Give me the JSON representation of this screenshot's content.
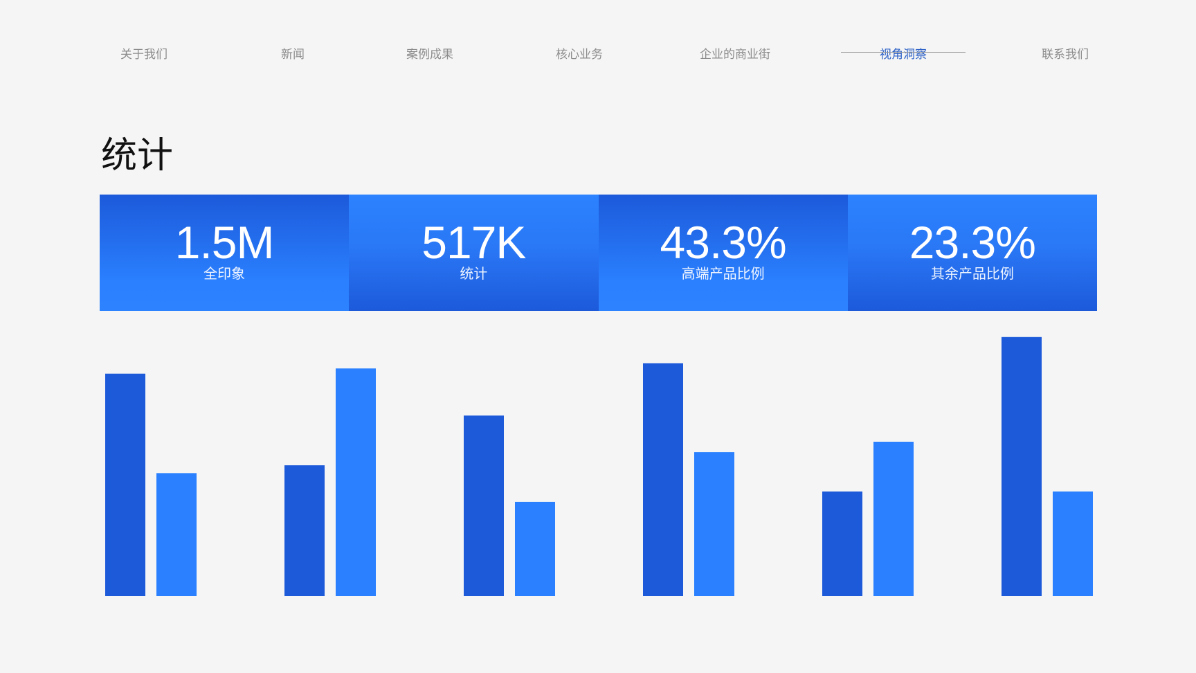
{
  "nav": {
    "items": [
      {
        "label": "关于我们",
        "active": false
      },
      {
        "label": "新闻",
        "active": false
      },
      {
        "label": "案例成果",
        "active": false
      },
      {
        "label": "核心业务",
        "active": false
      },
      {
        "label": "企业的商业街",
        "active": false
      },
      {
        "label": "视角洞察",
        "active": true
      },
      {
        "label": "联系我们",
        "active": false
      }
    ]
  },
  "page": {
    "title": "统计"
  },
  "stats": [
    {
      "value": "1.5M",
      "label": "全印象"
    },
    {
      "value": "517K",
      "label": "统计"
    },
    {
      "value": "43.3%",
      "label": "高端产品比例"
    },
    {
      "value": "23.3%",
      "label": "其余产品比例"
    }
  ],
  "colors": {
    "accent": "#2f63c8",
    "series_dark": "#1c5ada",
    "series_light": "#2a80ff",
    "background": "#f5f5f5"
  },
  "chart_data": {
    "type": "bar",
    "categories": [
      "",
      "",
      "",
      "",
      "",
      ""
    ],
    "series": [
      {
        "values": [
          85,
          50,
          69,
          89,
          40,
          99
        ],
        "color": "#1c5ada"
      },
      {
        "values": [
          47,
          87,
          36,
          55,
          59,
          40
        ],
        "color": "#2a80ff"
      }
    ],
    "ylim": [
      0,
      100
    ],
    "grid": false,
    "legend": "none",
    "title": "",
    "xlabel": "",
    "ylabel": ""
  }
}
